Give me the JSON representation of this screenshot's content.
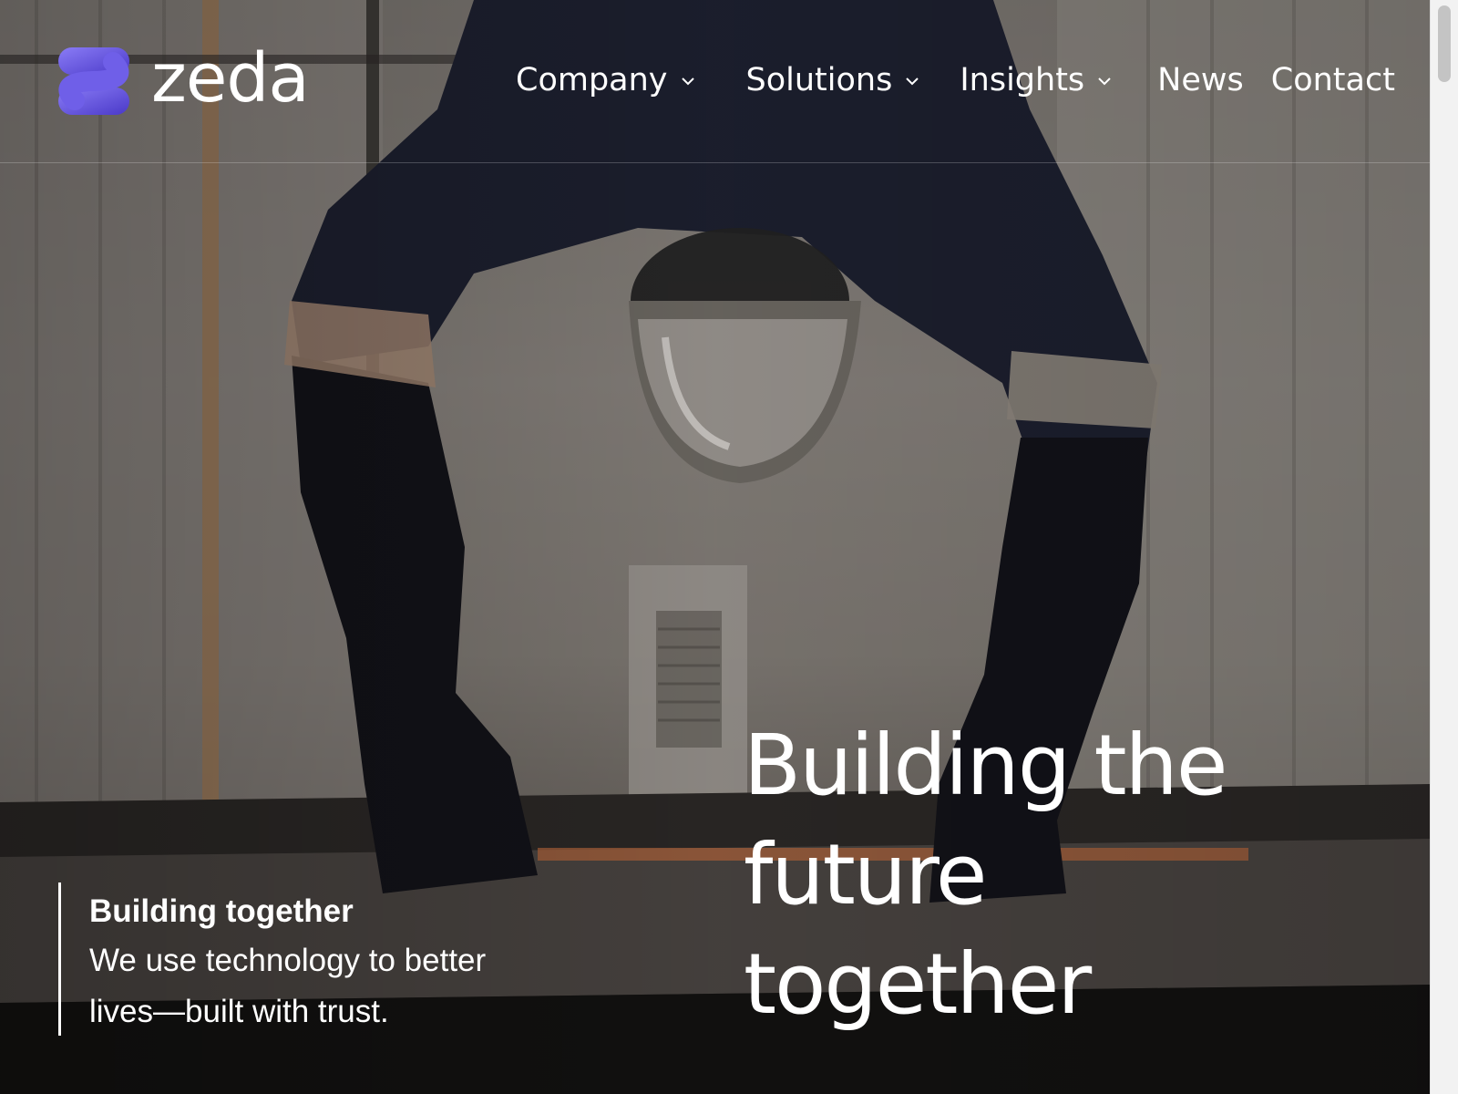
{
  "brand": {
    "name": "zeda",
    "logo_colors": [
      "#7b6cf0",
      "#5a48d8",
      "#3d2fb0"
    ]
  },
  "nav": {
    "items": [
      {
        "label": "Company",
        "has_dropdown": true
      },
      {
        "label": "Solutions",
        "has_dropdown": true
      },
      {
        "label": "Insights",
        "has_dropdown": true
      },
      {
        "label": "News",
        "has_dropdown": false
      },
      {
        "label": "Contact",
        "has_dropdown": false
      }
    ]
  },
  "hero": {
    "headline_lines": [
      "Building the",
      "future",
      "together"
    ],
    "tagline": {
      "title": "Building together",
      "body_lines": [
        "We use technology to better",
        "lives—built with trust."
      ]
    }
  },
  "icons": {
    "dropdown": "chevron-down-icon",
    "logo": "zeda-logo-icon"
  }
}
